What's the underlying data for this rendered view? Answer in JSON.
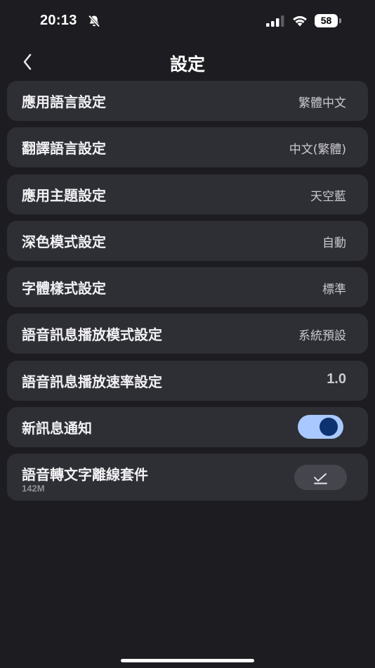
{
  "status_bar": {
    "time": "20:13",
    "battery_level": "58",
    "icons": [
      "bell-slash-icon",
      "cellular-signal-icon",
      "wifi-icon",
      "battery-icon"
    ]
  },
  "header": {
    "title": "設定",
    "back_icon": "chevron-left-icon"
  },
  "settings": {
    "items": [
      {
        "label": "應用語言設定",
        "value": "繁體中文"
      },
      {
        "label": "翻譯語言設定",
        "value": "中文(繁體)"
      },
      {
        "label": "應用主題設定",
        "value": "天空藍"
      },
      {
        "label": "深色模式設定",
        "value": "自動"
      },
      {
        "label": "字體樣式設定",
        "value": "標準"
      },
      {
        "label": "語音訊息播放模式設定",
        "value": "系統預設"
      },
      {
        "label": "語音訊息播放速率設定",
        "value": "1.0"
      }
    ],
    "notification": {
      "label": "新訊息通知",
      "enabled": true
    },
    "offline_package": {
      "label": "語音轉文字離線套件",
      "size": "142M",
      "icon": "checkmark-icon"
    }
  },
  "colors": {
    "background": "#1c1c21",
    "row_background": "#2e2f34",
    "toggle_track": "#a9c8ff",
    "toggle_knob": "#0c3270"
  }
}
